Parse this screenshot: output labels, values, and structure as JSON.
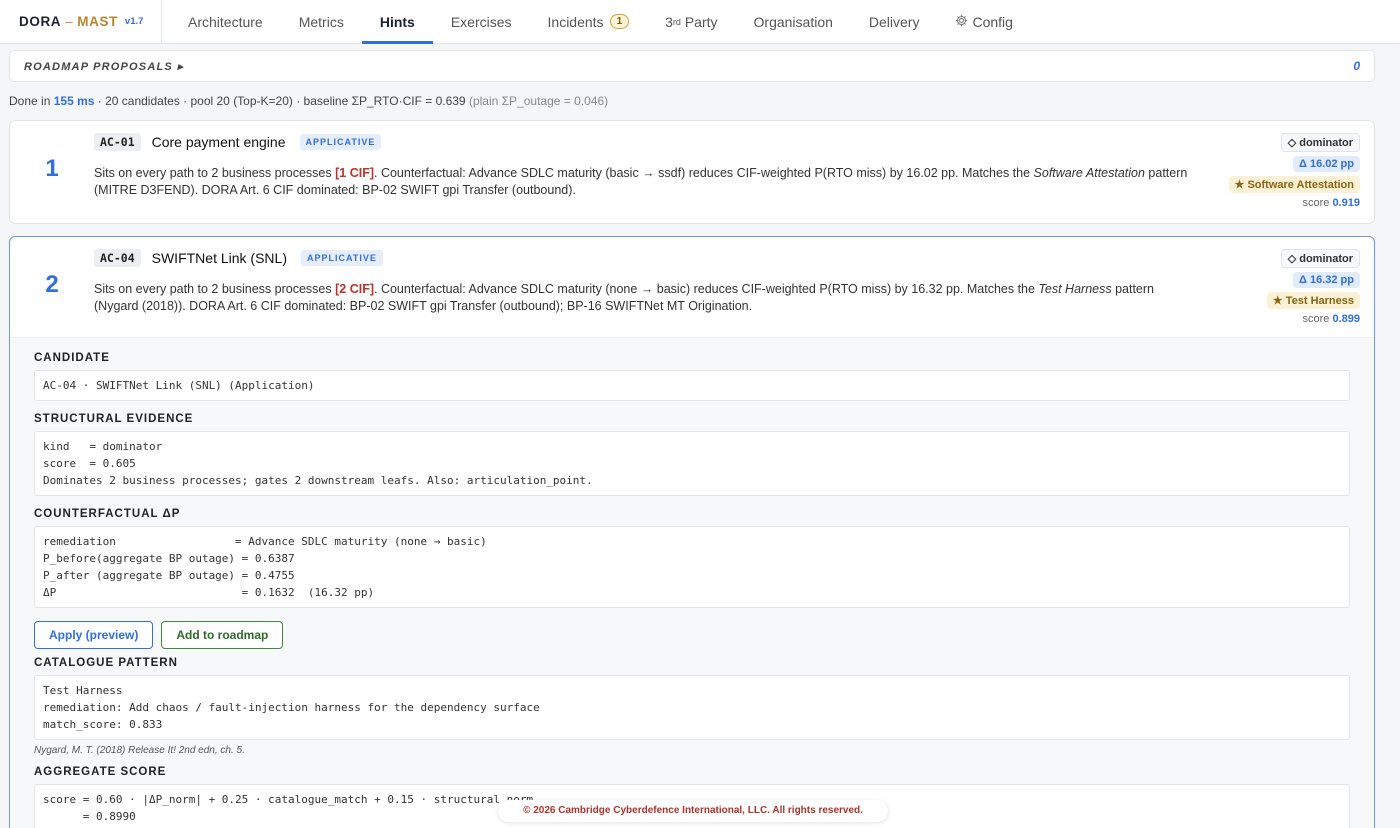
{
  "brand": {
    "name1": "DORA",
    "sep": "–",
    "name2": "MAST",
    "version": "v1.7"
  },
  "nav": {
    "tabs": [
      {
        "label": "Architecture"
      },
      {
        "label": "Metrics"
      },
      {
        "label": "Hints"
      },
      {
        "label": "Exercises"
      },
      {
        "label": "Incidents",
        "count": "1"
      },
      {
        "label": "3",
        "sup": "rd",
        "suffix": " Party"
      },
      {
        "label": "Organisation"
      },
      {
        "label": "Delivery"
      },
      {
        "label": "Config",
        "icon": "gear-icon"
      }
    ],
    "active": "Hints"
  },
  "proposals": {
    "label": "ROADMAP PROPOSALS ▸",
    "count": "0"
  },
  "status": {
    "prefix": "Done in",
    "ms": "155 ms",
    "rest": "· 20 candidates · pool 20 (Top-K=20) · baseline ΣP_RTO·CIF = 0.639",
    "muted": "(plain ΣP_outage = 0.046)"
  },
  "cards": [
    {
      "rank": "1",
      "code": "AC-01",
      "title": "Core payment engine",
      "tag": "APPLICATIVE",
      "desc_a": "Sits on every path to 2 business processes ",
      "cif": "[1 CIF]",
      "desc_b": ". Counterfactual: Advance SDLC maturity (basic → ssdf) reduces CIF-weighted P(RTO miss) by 16.02 pp. Matches the ",
      "pattern_it": "Software Attestation",
      "desc_c": " pattern (MITRE D3FEND). DORA Art. 6 CIF dominated: BP-02 SWIFT gpi Transfer (outbound).",
      "kind": "◇ dominator",
      "delta": "Δ 16.02 pp",
      "pattern": "★ Software Attestation",
      "score_label": "score",
      "score": "0.919"
    },
    {
      "rank": "2",
      "code": "AC-04",
      "title": "SWIFTNet Link (SNL)",
      "tag": "APPLICATIVE",
      "desc_a": "Sits on every path to 2 business processes ",
      "cif": "[2 CIF]",
      "desc_b": ". Counterfactual: Advance SDLC maturity (none → basic) reduces CIF-weighted P(RTO miss) by 16.32 pp. Matches the ",
      "pattern_it": "Test Harness",
      "desc_c": " pattern (Nygard (2018)). DORA Art. 6 CIF dominated: BP-02 SWIFT gpi Transfer (outbound); BP-16 SWIFTNet MT Origination.",
      "kind": "◇ dominator",
      "delta": "Δ 16.32 pp",
      "pattern": "★ Test Harness",
      "score_label": "score",
      "score": "0.899"
    }
  ],
  "detail": {
    "candidate_h": "CANDIDATE",
    "candidate": "AC-04 · SWIFTNet Link (SNL) (Application)",
    "structural_h": "STRUCTURAL EVIDENCE",
    "structural": "kind   = dominator\nscore  = 0.605\nDominates 2 business processes; gates 2 downstream leafs. Also: articulation_point.",
    "cf_h": "COUNTERFACTUAL ΔP",
    "cf": "remediation                  = Advance SDLC maturity (none → basic)\nP_before(aggregate BP outage) = 0.6387\nP_after (aggregate BP outage) = 0.4755\nΔP                            = 0.1632  (16.32 pp)",
    "apply_btn": "Apply (preview)",
    "roadmap_btn": "Add to roadmap",
    "catalogue_h": "CATALOGUE PATTERN",
    "catalogue": "Test Harness\nremediation: Add chaos / fault-injection harness for the dependency surface\nmatch_score: 0.833",
    "ref": "Nygard, M. T. (2018) Release It! 2nd edn, ch. 5.",
    "agg_h": "AGGREGATE SCORE",
    "agg": "score = 0.60 · |ΔP_norm| + 0.25 · catalogue_match + 0.15 · structural_norm\n      = 0.8990"
  },
  "footer": "© 2026 Cambridge Cyberdefence International, LLC. All rights reserved."
}
